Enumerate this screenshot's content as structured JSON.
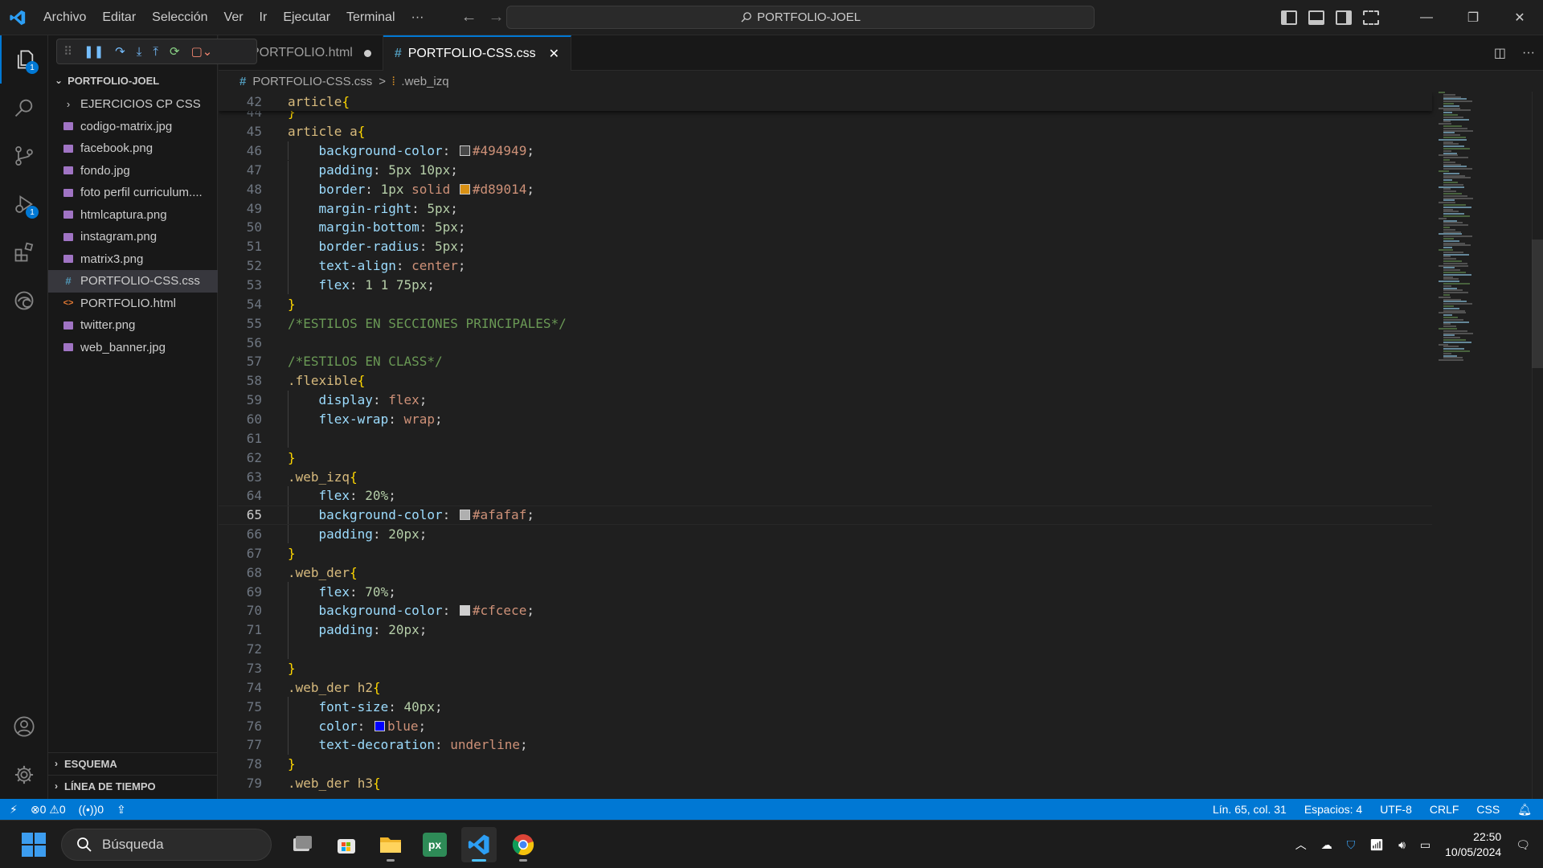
{
  "window": {
    "menu": [
      "Archivo",
      "Editar",
      "Selección",
      "Ver",
      "Ir",
      "Ejecutar",
      "Terminal"
    ],
    "more": "···",
    "search_title": "PORTFOLIO-JOEL"
  },
  "activity": {
    "explorer_badge": "1",
    "debug_badge": "1"
  },
  "explorer": {
    "folder": "PORTFOLIO-JOEL",
    "items": [
      {
        "label": "EJERCICIOS CP CSS",
        "kind": "folder"
      },
      {
        "label": "codigo-matrix.jpg",
        "kind": "image"
      },
      {
        "label": "facebook.png",
        "kind": "image"
      },
      {
        "label": "fondo.jpg",
        "kind": "image"
      },
      {
        "label": "foto perfil curriculum....",
        "kind": "image"
      },
      {
        "label": "htmlcaptura.png",
        "kind": "image"
      },
      {
        "label": "instagram.png",
        "kind": "image"
      },
      {
        "label": "matrix3.png",
        "kind": "image"
      },
      {
        "label": "PORTFOLIO-CSS.css",
        "kind": "css",
        "selected": true
      },
      {
        "label": "PORTFOLIO.html",
        "kind": "html"
      },
      {
        "label": "twitter.png",
        "kind": "image"
      },
      {
        "label": "web_banner.jpg",
        "kind": "image"
      }
    ],
    "outline": "ESQUEMA",
    "timeline": "LÍNEA DE TIEMPO"
  },
  "tabs": [
    {
      "label": "PORTFOLIO.html",
      "dirty": true,
      "active": false
    },
    {
      "label": "PORTFOLIO-CSS.css",
      "dirty": false,
      "active": true
    }
  ],
  "breadcrumb": {
    "file": "PORTFOLIO-CSS.css",
    "separator": ">",
    "symbol": ".web_izq"
  },
  "editor": {
    "current_line": 65,
    "sticky": {
      "n": 42,
      "tokens": [
        [
          "sel",
          "article"
        ],
        [
          "brace",
          "{"
        ]
      ]
    },
    "lines": [
      {
        "n": 44,
        "tokens": [
          [
            "brace",
            "}"
          ]
        ]
      },
      {
        "n": 45,
        "tokens": [
          [
            "sel",
            "article a"
          ],
          [
            "brace",
            "{"
          ]
        ]
      },
      {
        "n": 46,
        "indent": 1,
        "tokens": [
          [
            "prop",
            "background-color"
          ],
          [
            "punc",
            ": "
          ],
          [
            "swatch",
            "#494949"
          ],
          [
            "val",
            "#494949"
          ],
          [
            "punc",
            ";"
          ]
        ]
      },
      {
        "n": 47,
        "indent": 1,
        "tokens": [
          [
            "prop",
            "padding"
          ],
          [
            "punc",
            ": "
          ],
          [
            "num",
            "5px 10px"
          ],
          [
            "punc",
            ";"
          ]
        ]
      },
      {
        "n": 48,
        "indent": 1,
        "tokens": [
          [
            "prop",
            "border"
          ],
          [
            "punc",
            ": "
          ],
          [
            "num",
            "1px"
          ],
          [
            "val",
            " solid "
          ],
          [
            "swatch",
            "#d89014"
          ],
          [
            "val",
            "#d89014"
          ],
          [
            "punc",
            ";"
          ]
        ]
      },
      {
        "n": 49,
        "indent": 1,
        "tokens": [
          [
            "prop",
            "margin-right"
          ],
          [
            "punc",
            ": "
          ],
          [
            "num",
            "5px"
          ],
          [
            "punc",
            ";"
          ]
        ]
      },
      {
        "n": 50,
        "indent": 1,
        "tokens": [
          [
            "prop",
            "margin-bottom"
          ],
          [
            "punc",
            ": "
          ],
          [
            "num",
            "5px"
          ],
          [
            "punc",
            ";"
          ]
        ]
      },
      {
        "n": 51,
        "indent": 1,
        "tokens": [
          [
            "prop",
            "border-radius"
          ],
          [
            "punc",
            ": "
          ],
          [
            "num",
            "5px"
          ],
          [
            "punc",
            ";"
          ]
        ]
      },
      {
        "n": 52,
        "indent": 1,
        "tokens": [
          [
            "prop",
            "text-align"
          ],
          [
            "punc",
            ": "
          ],
          [
            "val",
            "center"
          ],
          [
            "punc",
            ";"
          ]
        ]
      },
      {
        "n": 53,
        "indent": 1,
        "tokens": [
          [
            "prop",
            "flex"
          ],
          [
            "punc",
            ": "
          ],
          [
            "num",
            "1 1 75px"
          ],
          [
            "punc",
            ";"
          ]
        ]
      },
      {
        "n": 54,
        "tokens": [
          [
            "brace",
            "}"
          ]
        ]
      },
      {
        "n": 55,
        "tokens": [
          [
            "comment",
            "/*ESTILOS EN SECCIONES PRINCIPALES*/"
          ]
        ]
      },
      {
        "n": 56,
        "tokens": []
      },
      {
        "n": 57,
        "tokens": [
          [
            "comment",
            "/*ESTILOS EN CLASS*/"
          ]
        ]
      },
      {
        "n": 58,
        "tokens": [
          [
            "sel",
            ".flexible"
          ],
          [
            "brace",
            "{"
          ]
        ]
      },
      {
        "n": 59,
        "indent": 1,
        "tokens": [
          [
            "prop",
            "display"
          ],
          [
            "punc",
            ": "
          ],
          [
            "val",
            "flex"
          ],
          [
            "punc",
            ";"
          ]
        ]
      },
      {
        "n": 60,
        "indent": 1,
        "tokens": [
          [
            "prop",
            "flex-wrap"
          ],
          [
            "punc",
            ": "
          ],
          [
            "val",
            "wrap"
          ],
          [
            "punc",
            ";"
          ]
        ]
      },
      {
        "n": 61,
        "indent": 1,
        "tokens": []
      },
      {
        "n": 62,
        "tokens": [
          [
            "brace",
            "}"
          ]
        ]
      },
      {
        "n": 63,
        "tokens": [
          [
            "sel",
            ".web_izq"
          ],
          [
            "brace",
            "{"
          ]
        ]
      },
      {
        "n": 64,
        "indent": 1,
        "tokens": [
          [
            "prop",
            "flex"
          ],
          [
            "punc",
            ": "
          ],
          [
            "num",
            "20%"
          ],
          [
            "punc",
            ";"
          ]
        ]
      },
      {
        "n": 65,
        "indent": 1,
        "tokens": [
          [
            "prop",
            "background-color"
          ],
          [
            "punc",
            ": "
          ],
          [
            "swatch",
            "#afafaf"
          ],
          [
            "val",
            "#afafaf"
          ],
          [
            "punc",
            ";"
          ]
        ]
      },
      {
        "n": 66,
        "indent": 1,
        "tokens": [
          [
            "prop",
            "padding"
          ],
          [
            "punc",
            ": "
          ],
          [
            "num",
            "20px"
          ],
          [
            "punc",
            ";"
          ]
        ]
      },
      {
        "n": 67,
        "tokens": [
          [
            "brace",
            "}"
          ]
        ]
      },
      {
        "n": 68,
        "tokens": [
          [
            "sel",
            ".web_der"
          ],
          [
            "brace",
            "{"
          ]
        ]
      },
      {
        "n": 69,
        "indent": 1,
        "tokens": [
          [
            "prop",
            "flex"
          ],
          [
            "punc",
            ": "
          ],
          [
            "num",
            "70%"
          ],
          [
            "punc",
            ";"
          ]
        ]
      },
      {
        "n": 70,
        "indent": 1,
        "tokens": [
          [
            "prop",
            "background-color"
          ],
          [
            "punc",
            ": "
          ],
          [
            "swatch",
            "#cfcece"
          ],
          [
            "val",
            "#cfcece"
          ],
          [
            "punc",
            ";"
          ]
        ]
      },
      {
        "n": 71,
        "indent": 1,
        "tokens": [
          [
            "prop",
            "padding"
          ],
          [
            "punc",
            ": "
          ],
          [
            "num",
            "20px"
          ],
          [
            "punc",
            ";"
          ]
        ]
      },
      {
        "n": 72,
        "indent": 1,
        "tokens": []
      },
      {
        "n": 73,
        "tokens": [
          [
            "brace",
            "}"
          ]
        ]
      },
      {
        "n": 74,
        "tokens": [
          [
            "sel",
            ".web_der h2"
          ],
          [
            "brace",
            "{"
          ]
        ]
      },
      {
        "n": 75,
        "indent": 1,
        "tokens": [
          [
            "prop",
            "font-size"
          ],
          [
            "punc",
            ": "
          ],
          [
            "num",
            "40px"
          ],
          [
            "punc",
            ";"
          ]
        ]
      },
      {
        "n": 76,
        "indent": 1,
        "tokens": [
          [
            "prop",
            "color"
          ],
          [
            "punc",
            ": "
          ],
          [
            "swatch",
            "#0000ff"
          ],
          [
            "val",
            "blue"
          ],
          [
            "punc",
            ";"
          ]
        ]
      },
      {
        "n": 77,
        "indent": 1,
        "tokens": [
          [
            "prop",
            "text-decoration"
          ],
          [
            "punc",
            ": "
          ],
          [
            "val",
            "underline"
          ],
          [
            "punc",
            ";"
          ]
        ]
      },
      {
        "n": 78,
        "tokens": [
          [
            "brace",
            "}"
          ]
        ]
      },
      {
        "n": 79,
        "tokens": [
          [
            "sel",
            ".web_der h3"
          ],
          [
            "brace",
            "{"
          ]
        ]
      }
    ]
  },
  "statusbar": {
    "errors": "0",
    "warnings": "0",
    "ports": "0",
    "position": "Lín. 65, col. 31",
    "spaces": "Espacios: 4",
    "encoding": "UTF-8",
    "eol": "CRLF",
    "language": "CSS"
  },
  "taskbar": {
    "search_label": "Búsqueda",
    "time": "22:50",
    "date": "10/05/2024"
  },
  "colors": {
    "accent": "#0078d4",
    "editor_bg": "#1f1f1f",
    "sidebar_bg": "#181818"
  }
}
